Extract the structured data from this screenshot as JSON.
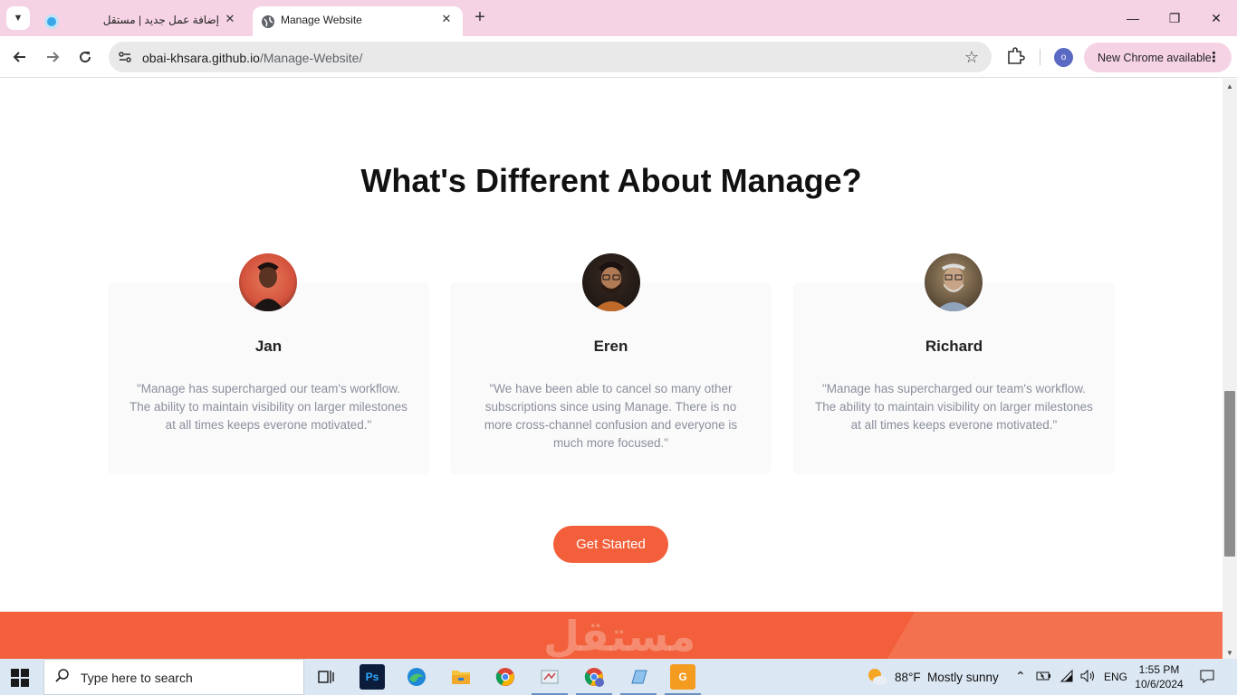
{
  "browser": {
    "tabs": [
      {
        "title": "إضافة عمل جديد | مستقل",
        "active": false
      },
      {
        "title": "Manage Website",
        "active": true
      }
    ],
    "url_host": "obai-khsara.github.io",
    "url_path": "/Manage-Website/",
    "profile_initial": "o",
    "update_chip": "New Chrome available"
  },
  "page": {
    "heading": "What's Different About Manage?",
    "testimonials": [
      {
        "name": "Jan",
        "quote": "\"Manage has supercharged our team's workflow. The ability to maintain visibility on larger milestones at all times keeps everone motivated.\""
      },
      {
        "name": "Eren",
        "quote": "\"We have been able to cancel so many other subscriptions since using Manage. There is no more cross-channel confusion and everyone is much more focused.\""
      },
      {
        "name": "Richard",
        "quote": "\"Manage has supercharged our team's workflow. The ability to maintain visibility on larger milestones at all times keeps everone motivated.\""
      }
    ],
    "cta_label": "Get Started",
    "watermark": "مستقل",
    "accent": "#f25f3a"
  },
  "taskbar": {
    "search_placeholder": "Type here to search",
    "weather_temp": "88°F",
    "weather_text": "Mostly sunny",
    "language": "ENG",
    "time": "1:55 PM",
    "date": "10/6/2024"
  }
}
